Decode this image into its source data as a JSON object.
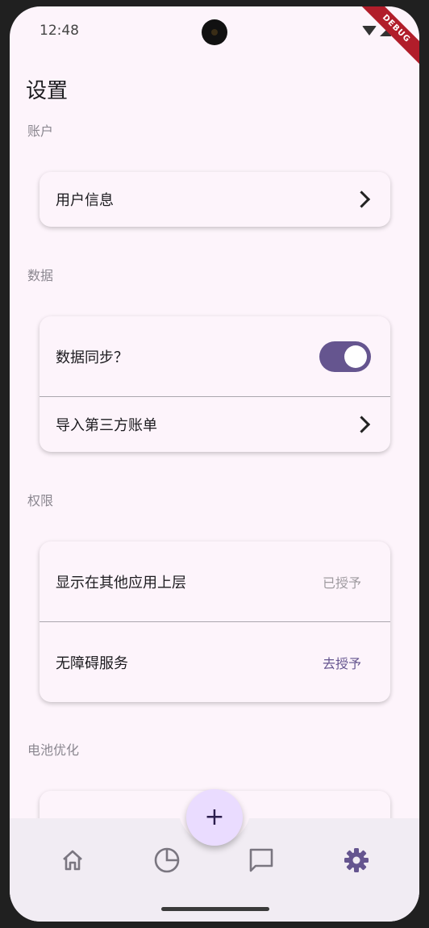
{
  "status": {
    "time": "12:48",
    "debug_label": "DEBUG"
  },
  "page": {
    "title": "设置"
  },
  "sections": {
    "account": {
      "label": "账户",
      "items": [
        {
          "label": "用户信息",
          "icon": "chevron-right-icon"
        }
      ]
    },
    "data": {
      "label": "数据",
      "items": [
        {
          "label": "数据同步？",
          "toggle": true
        },
        {
          "label": "导入第三方账单",
          "icon": "chevron-right-icon"
        }
      ]
    },
    "permissions": {
      "label": "权限",
      "items": [
        {
          "label": "显示在其他应用上层",
          "action": "已授予",
          "action_color": "#9e9a9f"
        },
        {
          "label": "无障碍服务",
          "action": "去授予",
          "action_color": "#65558f"
        }
      ]
    },
    "battery": {
      "label": "电池优化"
    }
  },
  "nav": {
    "items": [
      {
        "name": "home-icon",
        "active": false
      },
      {
        "name": "pie-chart-icon",
        "active": false
      },
      {
        "name": "chat-icon",
        "active": false
      },
      {
        "name": "settings-gear-icon",
        "active": true
      }
    ],
    "fab_symbol": "+"
  },
  "colors": {
    "accent": "#65558f",
    "background": "#fdf4fb",
    "fab": "#eadcff",
    "nav_background": "#f1ecf3"
  }
}
